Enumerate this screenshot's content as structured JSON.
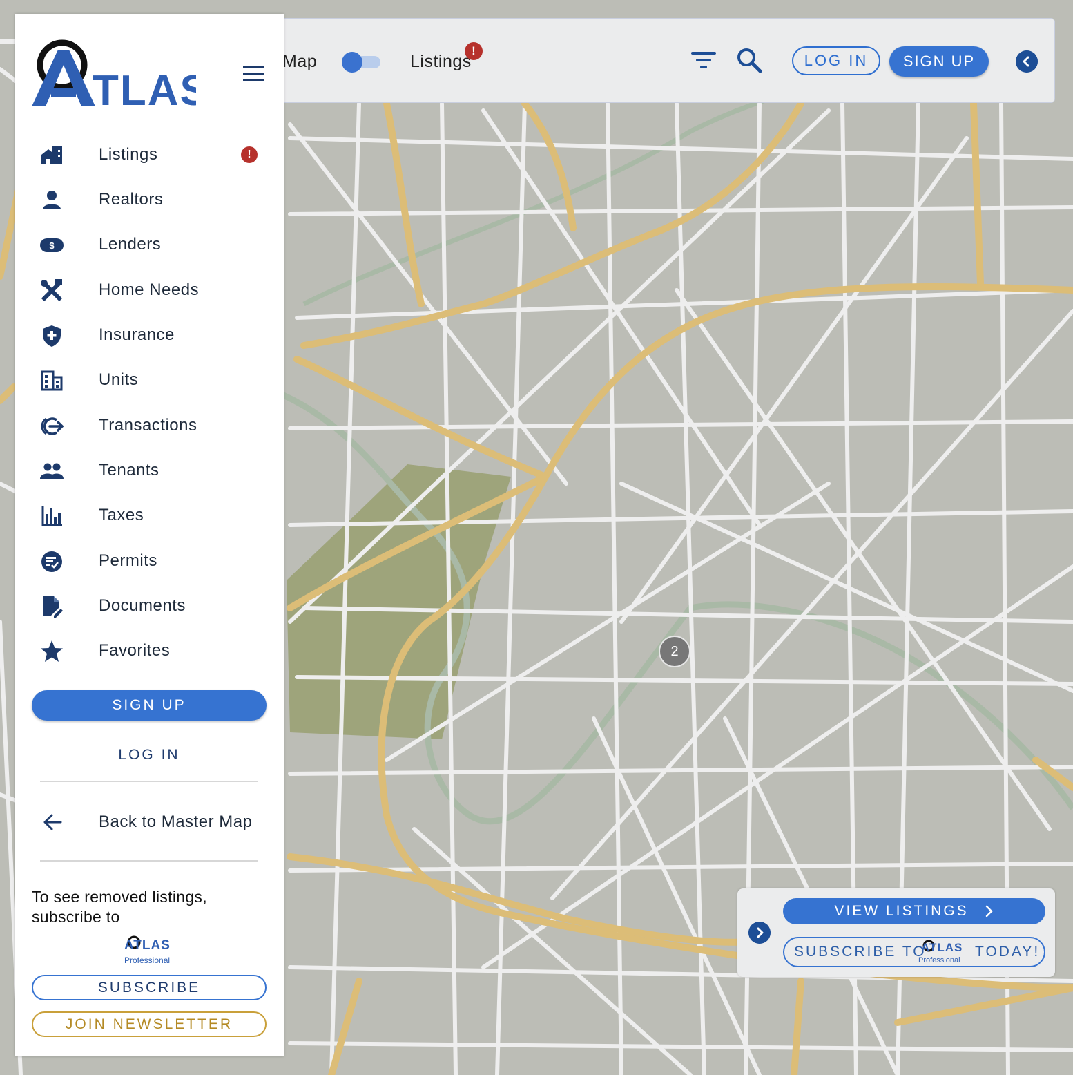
{
  "topbar": {
    "map_label": "Map",
    "listings_label": "Listings",
    "listings_alert": "!",
    "login_label": "LOG IN",
    "signup_label": "SIGN UP"
  },
  "sidebar": {
    "logo_text": "ATLAS",
    "items": [
      {
        "label": "Listings",
        "icon": "home-city-icon",
        "alert": "!"
      },
      {
        "label": "Realtors",
        "icon": "person-icon"
      },
      {
        "label": "Lenders",
        "icon": "money-icon"
      },
      {
        "label": "Home Needs",
        "icon": "tools-icon"
      },
      {
        "label": "Insurance",
        "icon": "shield-plus-icon"
      },
      {
        "label": "Units",
        "icon": "building-icon"
      },
      {
        "label": "Transactions",
        "icon": "exchange-icon"
      },
      {
        "label": "Tenants",
        "icon": "people-icon"
      },
      {
        "label": "Taxes",
        "icon": "bar-chart-icon"
      },
      {
        "label": "Permits",
        "icon": "permit-check-icon"
      },
      {
        "label": "Documents",
        "icon": "document-edit-icon"
      },
      {
        "label": "Favorites",
        "icon": "star-icon"
      }
    ],
    "signup_label": "SIGN UP",
    "login_label": "LOG IN",
    "back_label": "Back to Master Map",
    "promo_text": "To see removed listings, subscribe to",
    "pro_logo_text": "ATLAS",
    "pro_logo_sub": "Professional",
    "subscribe_label": "SUBSCRIBE",
    "newsletter_label": "JOIN NEWSLETTER"
  },
  "map": {
    "cluster_count": "2"
  },
  "bottom_panel": {
    "view_listings_label": "VIEW LISTINGS",
    "subscribe_prefix": "SUBSCRIBE TO",
    "subscribe_suffix": "TODAY!",
    "logo_text": "ATLAS",
    "logo_sub": "Professional"
  },
  "colors": {
    "accent": "#3673d1",
    "navy": "#1d3a6b",
    "alert": "#b6312c",
    "gold": "#c9a03a",
    "map_bg": "#bcbdb6",
    "road_major": "#dcbd77",
    "park": "#9ea47b"
  }
}
